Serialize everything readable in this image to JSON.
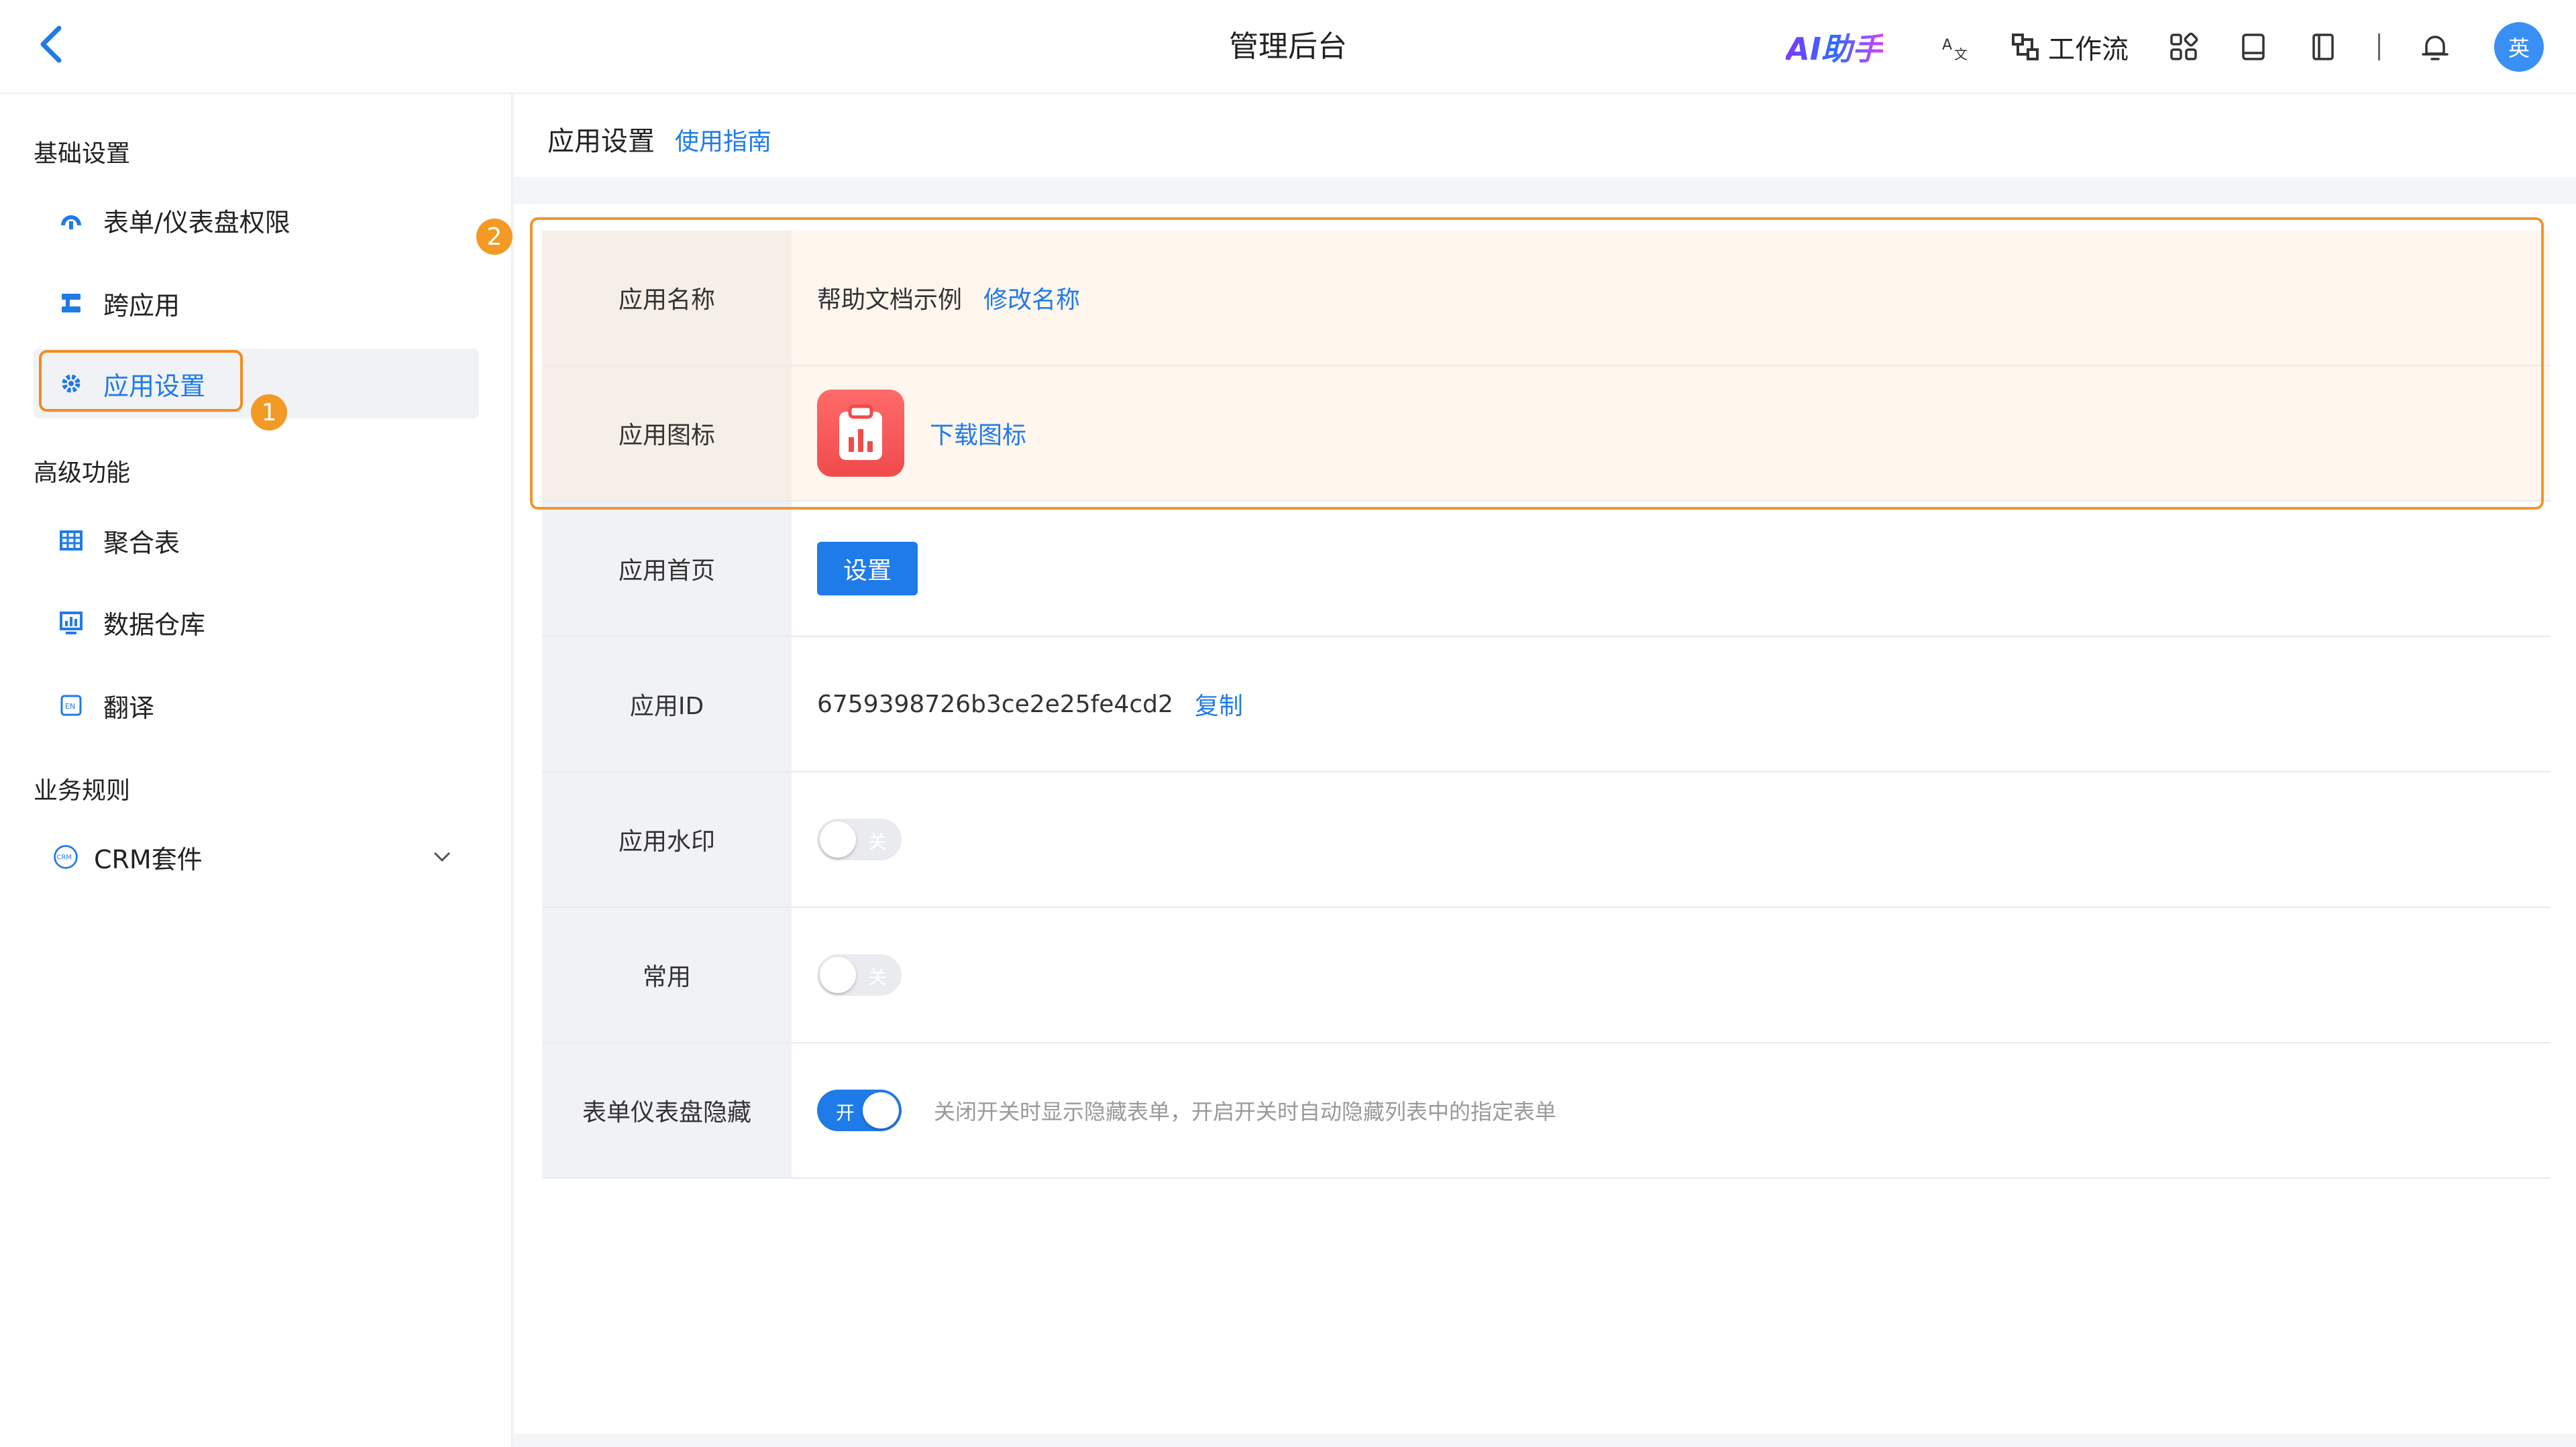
{
  "header": {
    "back_icon": "chevron-left-icon",
    "title": "管理后台",
    "ai_label": "AI助手",
    "workflow_label": "工作流",
    "avatar_text": "英"
  },
  "sidebar": {
    "groups": [
      {
        "title": "基础设置"
      },
      {
        "title": "高级功能"
      },
      {
        "title": "业务规则"
      }
    ],
    "items": [
      {
        "label": "表单/仪表盘权限",
        "icon": "shield-icon"
      },
      {
        "label": "跨应用",
        "icon": "link-apps-icon"
      },
      {
        "label": "应用设置",
        "icon": "gear-icon",
        "active": true
      },
      {
        "label": "聚合表",
        "icon": "table-icon"
      },
      {
        "label": "数据仓库",
        "icon": "chart-icon"
      },
      {
        "label": "翻译",
        "icon": "translate-icon"
      },
      {
        "label": "CRM套件",
        "icon": "crm-icon"
      }
    ]
  },
  "annotations": {
    "badge1": "1",
    "badge2": "2"
  },
  "main": {
    "title": "应用设置",
    "guide_link": "使用指南",
    "rows": {
      "name": {
        "label": "应用名称",
        "value": "帮助文档示例",
        "action": "修改名称"
      },
      "icon": {
        "label": "应用图标",
        "action": "下载图标"
      },
      "home": {
        "label": "应用首页",
        "button": "设置"
      },
      "id": {
        "label": "应用ID",
        "value": "6759398726b3ce2e25fe4cd2",
        "action": "复制"
      },
      "watermark": {
        "label": "应用水印",
        "toggle_text": "关"
      },
      "common": {
        "label": "常用",
        "toggle_text": "关"
      },
      "hide": {
        "label": "表单仪表盘隐藏",
        "toggle_text": "开",
        "hint": "关闭开关时显示隐藏表单，开启开关时自动隐藏列表中的指定表单"
      }
    }
  },
  "colors": {
    "accent": "#1f7be8",
    "highlight": "#f0962e",
    "app_icon": "#f04b4b"
  }
}
